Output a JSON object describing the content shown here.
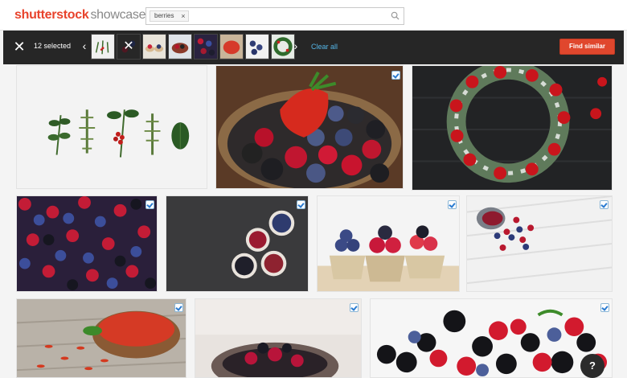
{
  "header": {
    "logo_brand": "shutterstock",
    "logo_sub": "showcase",
    "search": {
      "chip_label": "berries",
      "chip_remove": "×",
      "value": "",
      "placeholder": ""
    }
  },
  "selection_bar": {
    "close_glyph": "✕",
    "count_text": "12 selected",
    "prev_glyph": "‹",
    "next_glyph": "›",
    "thumb_remove_glyph": "✕",
    "clear_all_label": "Clear all",
    "find_similar_label": "Find similar"
  },
  "thumbnails": [
    {
      "subject": "winter greens flat lay"
    },
    {
      "subject": "berries on dark slate (hovered)"
    },
    {
      "subject": "berries in bowls"
    },
    {
      "subject": "mixed berries bowl"
    },
    {
      "subject": "berries close-up"
    },
    {
      "subject": "goji berries"
    },
    {
      "subject": "blueberries"
    },
    {
      "subject": "holly wreath"
    }
  ],
  "results": [
    {
      "subject": "holly and pine sprigs",
      "selected": false
    },
    {
      "subject": "strawberries and blackberries in basket",
      "selected": true
    },
    {
      "subject": "christmas wreath on dark wood",
      "selected": false
    },
    {
      "subject": "mixed berries texture",
      "selected": true
    },
    {
      "subject": "berry bowls on slate",
      "selected": false
    },
    {
      "subject": "berries in paper cups",
      "selected": true
    },
    {
      "subject": "spilled berries on white wood",
      "selected": true
    },
    {
      "subject": "goji berries in wooden bowl",
      "selected": true
    },
    {
      "subject": "berries in dark bowl",
      "selected": true
    },
    {
      "subject": "fresh blackberries and strawberries",
      "selected": true
    }
  ],
  "help_label": "?",
  "colors": {
    "brand": "#e8432c",
    "bar": "#262626",
    "link": "#55b6e8",
    "cta": "#e0472d"
  }
}
